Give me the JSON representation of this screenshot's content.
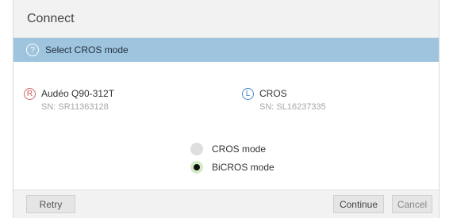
{
  "dialog": {
    "title": "Connect"
  },
  "banner": {
    "icon": "help-icon",
    "icon_glyph": "?",
    "text": "Select CROS mode"
  },
  "devices": {
    "left": {
      "badge": "R",
      "badge_color": "#c85858",
      "name": "Audéo Q90-312T",
      "serial": "SN: SR11363128"
    },
    "right": {
      "badge": "L",
      "badge_color": "#3d7cc0",
      "name": "CROS",
      "serial": "SN: SL16237335"
    }
  },
  "modes": {
    "options": [
      {
        "label": "CROS mode",
        "selected": false
      },
      {
        "label": "BiCROS mode",
        "selected": true
      }
    ]
  },
  "footer": {
    "retry_label": "Retry",
    "continue_label": "Continue",
    "cancel_label": "Cancel"
  },
  "colors": {
    "banner": "#9fc4de",
    "radio_selected": "#d4ecc5"
  }
}
